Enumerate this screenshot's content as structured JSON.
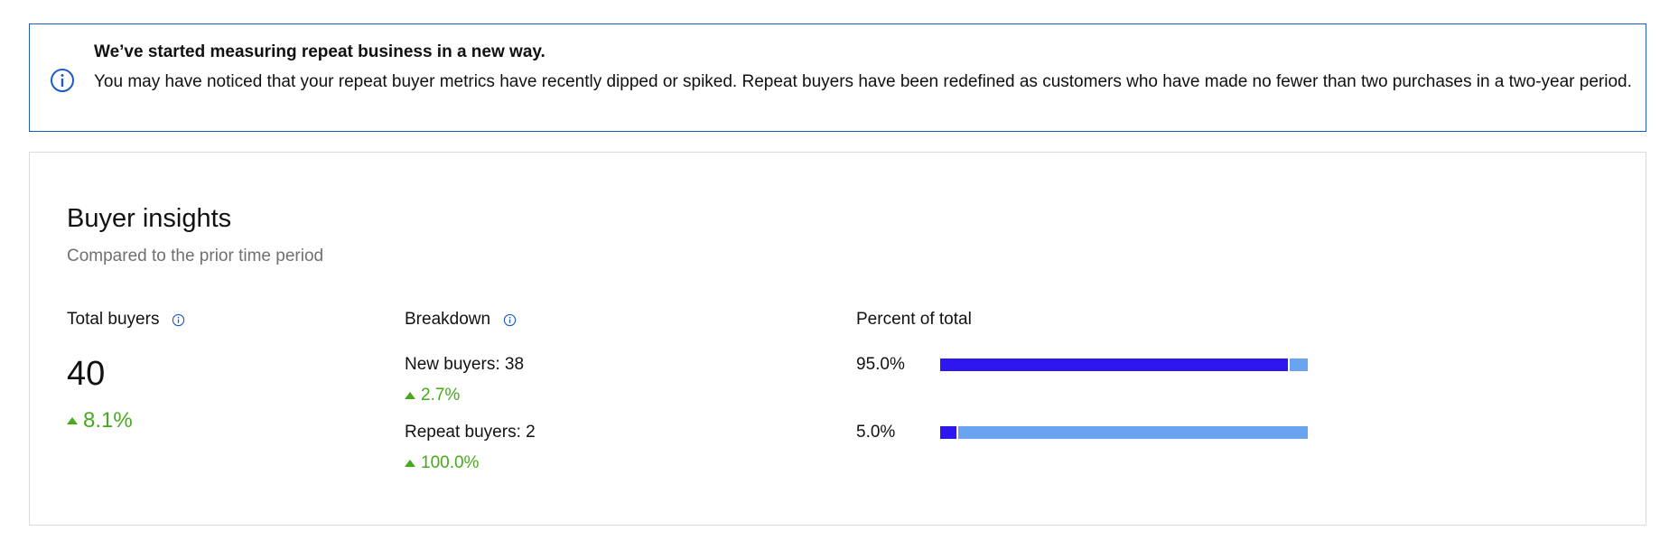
{
  "notice": {
    "title": "We’ve started measuring repeat business in a new way.",
    "body": "You may have noticed that your repeat buyer metrics have recently dipped or spiked. Repeat buyers have been redefined as customers who have made no fewer than two purchases in a two-year period.",
    "icon": "info-circle-icon"
  },
  "insights": {
    "title": "Buyer insights",
    "subtitle": "Compared to the prior time period",
    "total": {
      "header": "Total buyers",
      "value": "40",
      "change": "8.1%"
    },
    "breakdown": {
      "header": "Breakdown",
      "new_label": "New buyers: 38",
      "new_change": "2.7%",
      "repeat_label": "Repeat buyers: 2",
      "repeat_change": "100.0%"
    },
    "percent": {
      "header": "Percent of total",
      "rows": [
        {
          "label": "95.0%",
          "fraction": 0.95
        },
        {
          "label": "5.0%",
          "fraction": 0.05
        }
      ]
    }
  },
  "colors": {
    "accent": "#1e5bc6",
    "positive": "#47a91d",
    "bar_primary": "#2d16ee",
    "bar_track": "#6aa3f0"
  }
}
